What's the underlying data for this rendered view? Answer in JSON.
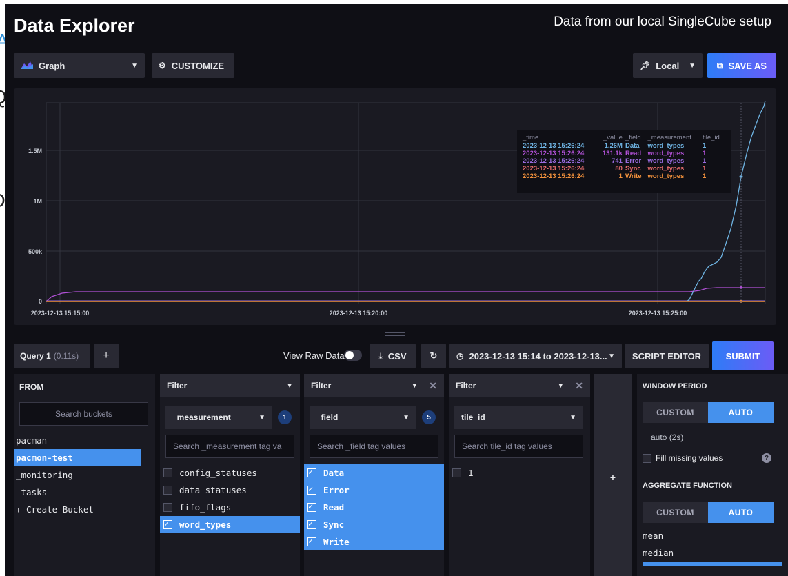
{
  "app": {
    "title": "Data Explorer",
    "subtitle": "Data from our local SingleCube setup"
  },
  "toolbar": {
    "view_label": "Graph",
    "customize_label": "CUSTOMIZE",
    "timezone_label": "Local",
    "save_as_label": "SAVE AS"
  },
  "graph": {
    "y_ticks": [
      "1.5M",
      "1M",
      "500k",
      "0"
    ],
    "x_ticks": [
      "2023-12-13 15:15:00",
      "2023-12-13 15:20:00",
      "2023-12-13 15:25:00"
    ],
    "colors": {
      "Data": "#6fb4e3",
      "Read": "#b151d6",
      "Error": "#9a6ce0",
      "Sync": "#e46b6b",
      "Write": "#f2913c",
      "grid": "#33343f"
    },
    "legend": {
      "headers": [
        "_time",
        "_value",
        "_field",
        "_measurement",
        "tile_id"
      ],
      "rows": [
        {
          "time": "2023-12-13 15:26:24",
          "value": "1.26M",
          "field": "Data",
          "measurement": "word_types",
          "tile_id": "1",
          "color": "#6fb4e3"
        },
        {
          "time": "2023-12-13 15:26:24",
          "value": "131.1k",
          "field": "Read",
          "measurement": "word_types",
          "tile_id": "1",
          "color": "#b151d6"
        },
        {
          "time": "2023-12-13 15:26:24",
          "value": "741",
          "field": "Error",
          "measurement": "word_types",
          "tile_id": "1",
          "color": "#9a6ce0"
        },
        {
          "time": "2023-12-13 15:26:24",
          "value": "80",
          "field": "Sync",
          "measurement": "word_types",
          "tile_id": "1",
          "color": "#e46b6b"
        },
        {
          "time": "2023-12-13 15:26:24",
          "value": "1",
          "field": "Write",
          "measurement": "word_types",
          "tile_id": "1",
          "color": "#f2913c"
        }
      ]
    }
  },
  "query_bar": {
    "tab_label": "Query 1",
    "tab_time": "(0.11s)",
    "add_label": "+",
    "raw_data_label": "View Raw Data",
    "csv_label": "CSV",
    "time_range_label": "2023-12-13 15:14 to 2023-12-13...",
    "script_editor_label": "SCRIPT EDITOR",
    "submit_label": "SUBMIT"
  },
  "from": {
    "header": "FROM",
    "search_placeholder": "Search buckets",
    "buckets": [
      "pacman",
      "pacmon-test",
      "_monitoring",
      "_tasks",
      "+ Create Bucket"
    ]
  },
  "filters": [
    {
      "label": "Filter",
      "key": "_measurement",
      "count": "1",
      "search_placeholder": "Search _measurement tag va",
      "values": [
        "config_statuses",
        "data_statuses",
        "fifo_flags",
        "word_types"
      ]
    },
    {
      "label": "Filter",
      "key": "_field",
      "count": "5",
      "search_placeholder": "Search _field tag values",
      "values": [
        "Data",
        "Error",
        "Read",
        "Sync",
        "Write"
      ]
    },
    {
      "label": "Filter",
      "key": "tile_id",
      "search_placeholder": "Search tile_id tag values",
      "values": [
        "1"
      ]
    }
  ],
  "add_filter_label": "+",
  "window": {
    "header": "WINDOW PERIOD",
    "custom_label": "CUSTOM",
    "auto_label": "AUTO",
    "auto_value": "auto (2s)",
    "fill_missing_label": "Fill missing values",
    "aggregate_header": "AGGREGATE FUNCTION",
    "functions": [
      "mean",
      "median"
    ]
  }
}
